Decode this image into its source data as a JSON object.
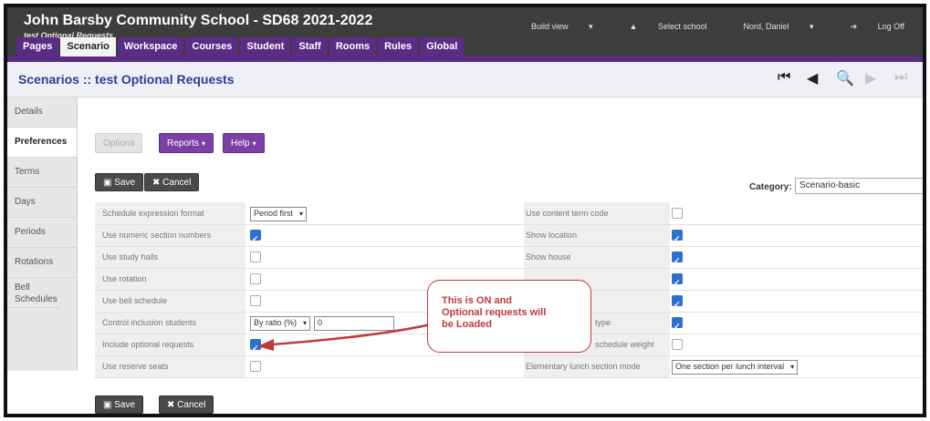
{
  "header": {
    "school_title": "John Barsby Community School - SD68 2021-2022",
    "subtitle": "test Optional Requests",
    "nav": [
      "Build view",
      "Select school",
      "Nord, Daniel",
      "Log Off"
    ]
  },
  "tabs": [
    "Pages",
    "Scenario",
    "Workspace",
    "Courses",
    "Student",
    "Staff",
    "Rooms",
    "Rules",
    "Global"
  ],
  "active_tab": "Scenario",
  "title": "Scenarios :: test Optional Requests",
  "sidenav": [
    "Details",
    "Preferences",
    "Terms",
    "Days",
    "Periods",
    "Rotations",
    "Bell Schedules"
  ],
  "toolbar": {
    "options_label": "Options",
    "reports_label": "Reports",
    "help_label": "Help",
    "save_label": "Save",
    "cancel_label": "Cancel"
  },
  "category": {
    "label": "Category:",
    "value": "Scenario-basic"
  },
  "left_fields": [
    {
      "label": "Schedule expression format",
      "type": "select",
      "value": "Period first"
    },
    {
      "label": "Use numeric section numbers",
      "type": "checkbox",
      "checked": true
    },
    {
      "label": "Use study halls",
      "type": "checkbox",
      "checked": false
    },
    {
      "label": "Use rotation",
      "type": "checkbox",
      "checked": false
    },
    {
      "label": "Use bell schedule",
      "type": "checkbox",
      "checked": false
    },
    {
      "label": "Control inclusion students",
      "type": "select-text",
      "value": "By ratio (%)",
      "text": "0"
    },
    {
      "label": "Include optional requests",
      "type": "checkbox",
      "checked": true
    },
    {
      "label": "Use reserve seats",
      "type": "checkbox",
      "checked": false
    }
  ],
  "right_fields": [
    {
      "label": "Use content term code",
      "type": "checkbox",
      "checked": false
    },
    {
      "label": "Show location",
      "type": "checkbox",
      "checked": true
    },
    {
      "label": "Show house",
      "type": "checkbox",
      "checked": true
    },
    {
      "label": "",
      "type": "checkbox",
      "checked": true
    },
    {
      "label": "",
      "type": "checkbox",
      "checked": true
    },
    {
      "label": "type",
      "type": "checkbox",
      "checked": true
    },
    {
      "label": "schedule weight",
      "type": "checkbox",
      "checked": false
    },
    {
      "label": "Elementary lunch section mode",
      "type": "select",
      "value": "One section per lunch interval"
    }
  ],
  "callout": {
    "line1": "This is ON and",
    "line2": "Optional requests will",
    "line3": "be Loaded",
    "color": "#c0393b"
  },
  "colors": {
    "brand_purple": "#5b2c83",
    "title_blue": "#2b3c9b",
    "checkbox_blue": "#2f6fd1"
  }
}
